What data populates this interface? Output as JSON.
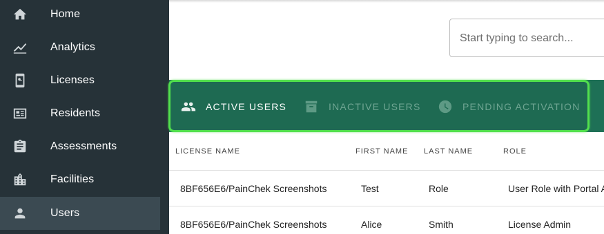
{
  "sidebar": {
    "items": [
      {
        "label": "Home",
        "icon": "home-icon"
      },
      {
        "label": "Analytics",
        "icon": "analytics-icon"
      },
      {
        "label": "Licenses",
        "icon": "licenses-icon"
      },
      {
        "label": "Residents",
        "icon": "residents-icon"
      },
      {
        "label": "Assessments",
        "icon": "assessments-icon"
      },
      {
        "label": "Facilities",
        "icon": "facilities-icon"
      },
      {
        "label": "Users",
        "icon": "user-icon"
      }
    ],
    "active": "Users"
  },
  "search": {
    "placeholder": "Start typing to search..."
  },
  "tabs": [
    {
      "label": "ACTIVE USERS",
      "icon": "people-icon",
      "active": true
    },
    {
      "label": "INACTIVE USERS",
      "icon": "archive-icon",
      "active": false
    },
    {
      "label": "PENDING ACTIVATION",
      "icon": "clock-icon",
      "active": false
    }
  ],
  "table": {
    "headers": [
      "LICENSE NAME",
      "FIRST NAME",
      "LAST NAME",
      "ROLE"
    ],
    "rows": [
      [
        "8BF656E6/PainChek Screenshots",
        "Test",
        "Role",
        "User Role with Portal A"
      ],
      [
        "8BF656E6/PainChek Screenshots",
        "Alice",
        "Smith",
        "License Admin"
      ]
    ]
  },
  "colors": {
    "sidebar_bg": "#263238",
    "tab_bar_bg": "#1e7056",
    "highlight_border": "#52e04d"
  }
}
